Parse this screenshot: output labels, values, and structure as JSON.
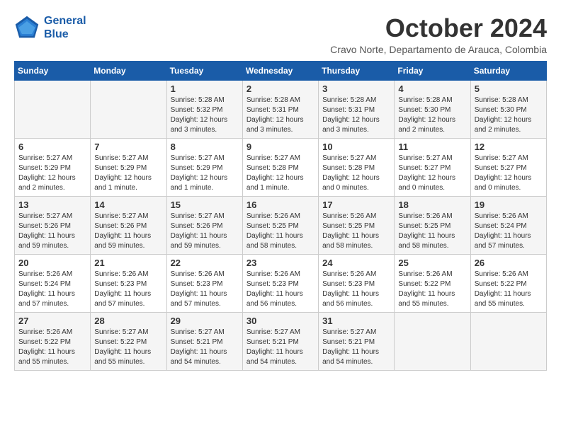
{
  "logo": {
    "line1": "General",
    "line2": "Blue"
  },
  "title": "October 2024",
  "subtitle": "Cravo Norte, Departamento de Arauca, Colombia",
  "weekdays": [
    "Sunday",
    "Monday",
    "Tuesday",
    "Wednesday",
    "Thursday",
    "Friday",
    "Saturday"
  ],
  "weeks": [
    [
      {
        "day": "",
        "info": ""
      },
      {
        "day": "",
        "info": ""
      },
      {
        "day": "1",
        "info": "Sunrise: 5:28 AM\nSunset: 5:32 PM\nDaylight: 12 hours and 3 minutes."
      },
      {
        "day": "2",
        "info": "Sunrise: 5:28 AM\nSunset: 5:31 PM\nDaylight: 12 hours and 3 minutes."
      },
      {
        "day": "3",
        "info": "Sunrise: 5:28 AM\nSunset: 5:31 PM\nDaylight: 12 hours and 3 minutes."
      },
      {
        "day": "4",
        "info": "Sunrise: 5:28 AM\nSunset: 5:30 PM\nDaylight: 12 hours and 2 minutes."
      },
      {
        "day": "5",
        "info": "Sunrise: 5:28 AM\nSunset: 5:30 PM\nDaylight: 12 hours and 2 minutes."
      }
    ],
    [
      {
        "day": "6",
        "info": "Sunrise: 5:27 AM\nSunset: 5:29 PM\nDaylight: 12 hours and 2 minutes."
      },
      {
        "day": "7",
        "info": "Sunrise: 5:27 AM\nSunset: 5:29 PM\nDaylight: 12 hours and 1 minute."
      },
      {
        "day": "8",
        "info": "Sunrise: 5:27 AM\nSunset: 5:29 PM\nDaylight: 12 hours and 1 minute."
      },
      {
        "day": "9",
        "info": "Sunrise: 5:27 AM\nSunset: 5:28 PM\nDaylight: 12 hours and 1 minute."
      },
      {
        "day": "10",
        "info": "Sunrise: 5:27 AM\nSunset: 5:28 PM\nDaylight: 12 hours and 0 minutes."
      },
      {
        "day": "11",
        "info": "Sunrise: 5:27 AM\nSunset: 5:27 PM\nDaylight: 12 hours and 0 minutes."
      },
      {
        "day": "12",
        "info": "Sunrise: 5:27 AM\nSunset: 5:27 PM\nDaylight: 12 hours and 0 minutes."
      }
    ],
    [
      {
        "day": "13",
        "info": "Sunrise: 5:27 AM\nSunset: 5:26 PM\nDaylight: 11 hours and 59 minutes."
      },
      {
        "day": "14",
        "info": "Sunrise: 5:27 AM\nSunset: 5:26 PM\nDaylight: 11 hours and 59 minutes."
      },
      {
        "day": "15",
        "info": "Sunrise: 5:27 AM\nSunset: 5:26 PM\nDaylight: 11 hours and 59 minutes."
      },
      {
        "day": "16",
        "info": "Sunrise: 5:26 AM\nSunset: 5:25 PM\nDaylight: 11 hours and 58 minutes."
      },
      {
        "day": "17",
        "info": "Sunrise: 5:26 AM\nSunset: 5:25 PM\nDaylight: 11 hours and 58 minutes."
      },
      {
        "day": "18",
        "info": "Sunrise: 5:26 AM\nSunset: 5:25 PM\nDaylight: 11 hours and 58 minutes."
      },
      {
        "day": "19",
        "info": "Sunrise: 5:26 AM\nSunset: 5:24 PM\nDaylight: 11 hours and 57 minutes."
      }
    ],
    [
      {
        "day": "20",
        "info": "Sunrise: 5:26 AM\nSunset: 5:24 PM\nDaylight: 11 hours and 57 minutes."
      },
      {
        "day": "21",
        "info": "Sunrise: 5:26 AM\nSunset: 5:23 PM\nDaylight: 11 hours and 57 minutes."
      },
      {
        "day": "22",
        "info": "Sunrise: 5:26 AM\nSunset: 5:23 PM\nDaylight: 11 hours and 57 minutes."
      },
      {
        "day": "23",
        "info": "Sunrise: 5:26 AM\nSunset: 5:23 PM\nDaylight: 11 hours and 56 minutes."
      },
      {
        "day": "24",
        "info": "Sunrise: 5:26 AM\nSunset: 5:23 PM\nDaylight: 11 hours and 56 minutes."
      },
      {
        "day": "25",
        "info": "Sunrise: 5:26 AM\nSunset: 5:22 PM\nDaylight: 11 hours and 55 minutes."
      },
      {
        "day": "26",
        "info": "Sunrise: 5:26 AM\nSunset: 5:22 PM\nDaylight: 11 hours and 55 minutes."
      }
    ],
    [
      {
        "day": "27",
        "info": "Sunrise: 5:26 AM\nSunset: 5:22 PM\nDaylight: 11 hours and 55 minutes."
      },
      {
        "day": "28",
        "info": "Sunrise: 5:27 AM\nSunset: 5:22 PM\nDaylight: 11 hours and 55 minutes."
      },
      {
        "day": "29",
        "info": "Sunrise: 5:27 AM\nSunset: 5:21 PM\nDaylight: 11 hours and 54 minutes."
      },
      {
        "day": "30",
        "info": "Sunrise: 5:27 AM\nSunset: 5:21 PM\nDaylight: 11 hours and 54 minutes."
      },
      {
        "day": "31",
        "info": "Sunrise: 5:27 AM\nSunset: 5:21 PM\nDaylight: 11 hours and 54 minutes."
      },
      {
        "day": "",
        "info": ""
      },
      {
        "day": "",
        "info": ""
      }
    ]
  ]
}
